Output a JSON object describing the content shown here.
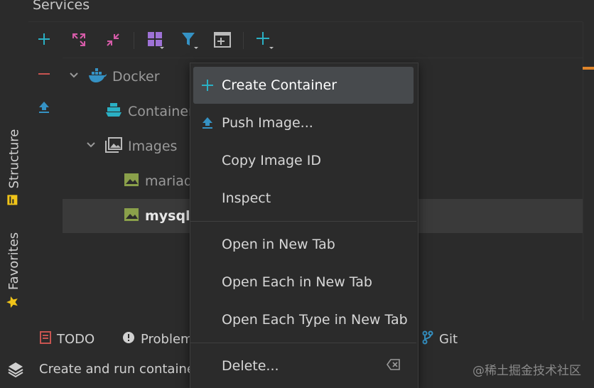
{
  "panel": {
    "title": "Services"
  },
  "left_strip": {
    "tabs": [
      {
        "label": "Structure",
        "icon": "structure-icon"
      },
      {
        "label": "Favorites",
        "icon": "star-icon"
      }
    ]
  },
  "side_actions": [
    {
      "icon": "add-icon"
    },
    {
      "icon": "remove-icon"
    },
    {
      "icon": "push-icon"
    }
  ],
  "toolbar": {
    "buttons": [
      {
        "icon": "expand-all-icon"
      },
      {
        "icon": "collapse-all-icon"
      },
      {
        "icon": "group-by-icon"
      },
      {
        "icon": "filter-icon"
      },
      {
        "icon": "new-tab-icon"
      },
      {
        "icon": "add-service-icon"
      }
    ]
  },
  "tree": {
    "rows": [
      {
        "label": "Docker",
        "icon": "docker-icon",
        "expanded": true
      },
      {
        "label": "Containers",
        "icon": "container-icon"
      },
      {
        "label": "Images",
        "icon": "images-icon",
        "expanded": true
      },
      {
        "label": "mariadb",
        "icon": "image-icon"
      },
      {
        "label": "mysql:",
        "icon": "image-icon",
        "selected": true
      }
    ]
  },
  "context_menu": {
    "items": [
      {
        "label": "Create Container",
        "icon": "plus-icon",
        "active": true
      },
      {
        "label": "Push Image...",
        "icon": "push-icon"
      },
      {
        "label": "Copy Image ID"
      },
      {
        "label": "Inspect"
      },
      {
        "label": "Open in New Tab"
      },
      {
        "label": "Open Each in New Tab"
      },
      {
        "label": "Open Each Type in New Tab"
      },
      {
        "label": "Delete...",
        "shortcut_icon": "backspace-icon"
      }
    ]
  },
  "bottom_bar": {
    "items": [
      {
        "label": "TODO",
        "icon": "todo-icon"
      },
      {
        "label": "Problems",
        "icon": "problems-icon"
      },
      {
        "label": "Git",
        "icon": "git-icon"
      }
    ]
  },
  "status_bar": {
    "text": "Create and run container",
    "watermark": "@稀土掘金技术社区"
  },
  "colors": {
    "accent_blue": "#3592c4",
    "accent_cyan": "#2ab0c4",
    "red": "#c75450",
    "yellow": "#f0c419",
    "orange": "#e0852a",
    "image_green": "#8aa04a"
  }
}
